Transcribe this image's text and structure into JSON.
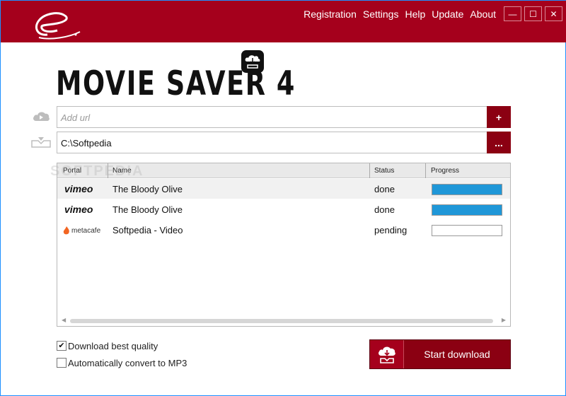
{
  "menu": [
    "Registration",
    "Settings",
    "Help",
    "Update",
    "About"
  ],
  "window_controls": {
    "minimize": "—",
    "maximize": "☐",
    "close": "✕"
  },
  "brand": {
    "title": "MOVIE SAVER 4"
  },
  "url_input": {
    "placeholder": "Add url",
    "add_label": "+"
  },
  "path_input": {
    "value": "C:\\Softpedia",
    "browse_label": "..."
  },
  "table": {
    "headers": {
      "portal": "Portal",
      "name": "Name",
      "status": "Status",
      "progress": "Progress"
    },
    "rows": [
      {
        "portal": "vimeo",
        "name": "The Bloody Olive",
        "status": "done",
        "progress": 1.0
      },
      {
        "portal": "vimeo",
        "name": "The Bloody Olive",
        "status": "done",
        "progress": 1.0
      },
      {
        "portal": "metacafe",
        "name": "Softpedia - Video",
        "status": "pending",
        "progress": 0.0
      }
    ]
  },
  "options": {
    "best_quality": {
      "label": "Download best quality",
      "checked": true
    },
    "convert_mp3": {
      "label": "Automatically convert to MP3",
      "checked": false
    }
  },
  "start_button": {
    "label": "Start download"
  },
  "watermark": "SOFTPEDIA",
  "colors": {
    "accent": "#a5001c",
    "dark_accent": "#8b0012",
    "progress": "#1f97d8"
  }
}
